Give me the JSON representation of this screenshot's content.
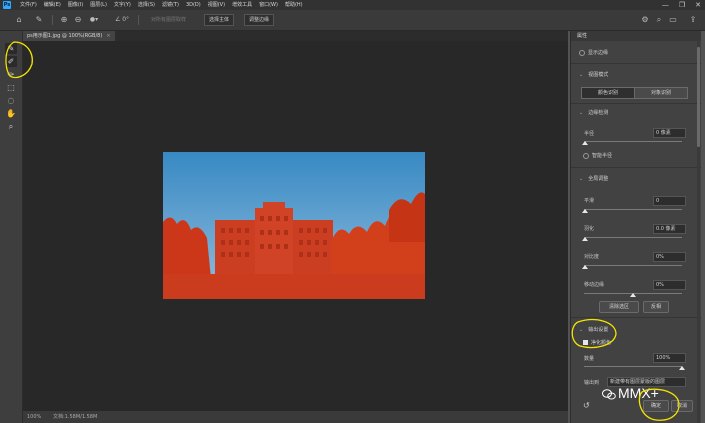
{
  "menubar": {
    "logo": "Ps",
    "items": [
      "文件(F)",
      "编辑(E)",
      "图像(I)",
      "图层(L)",
      "文字(Y)",
      "选择(S)",
      "滤镜(T)",
      "3D(D)",
      "视图(V)",
      "增效工具",
      "窗口(W)",
      "帮助(H)"
    ],
    "minimize": "—",
    "restore": "❐",
    "close": "✕"
  },
  "options": {
    "btn_sample": "对所有图层取样",
    "btn_subject": "选择主体",
    "btn_refine": "调整边缘"
  },
  "tab": {
    "title": "ps用示图1.jpg @ 100%(RGB/8)",
    "close": "×"
  },
  "status": {
    "zoom": "100%",
    "info": "文档:1.58M/1.58M"
  },
  "panel": {
    "header": "属性",
    "show_edge": "显示边缘",
    "view_mode": "视图模式",
    "mode_a": "颜色识别",
    "mode_b": "对象识别",
    "edge_detect": "边缘检测",
    "radius_label": "半径",
    "radius_value": "0 像素",
    "smart_radius": "智能半径",
    "global_adjust": "全局调整",
    "smooth_label": "平滑",
    "smooth_value": "0",
    "feather_label": "羽化",
    "feather_value": "0.0 像素",
    "contrast_label": "对比度",
    "contrast_value": "0%",
    "shift_label": "移动边缘",
    "shift_value": "0%",
    "clear_sel": "清除选区",
    "invert": "反相",
    "output": "输出设置",
    "decontam": "净化颜色",
    "amount_label": "数量",
    "amount_value": "100%",
    "output_to_label": "输出到",
    "output_to_value": "新建带有图层蒙版的图层",
    "ok": "确定",
    "cancel": "取消"
  },
  "watermark": "MMX+",
  "colors": {
    "annotation": "#f5e400",
    "selection_overlay": "#d83a1a"
  }
}
